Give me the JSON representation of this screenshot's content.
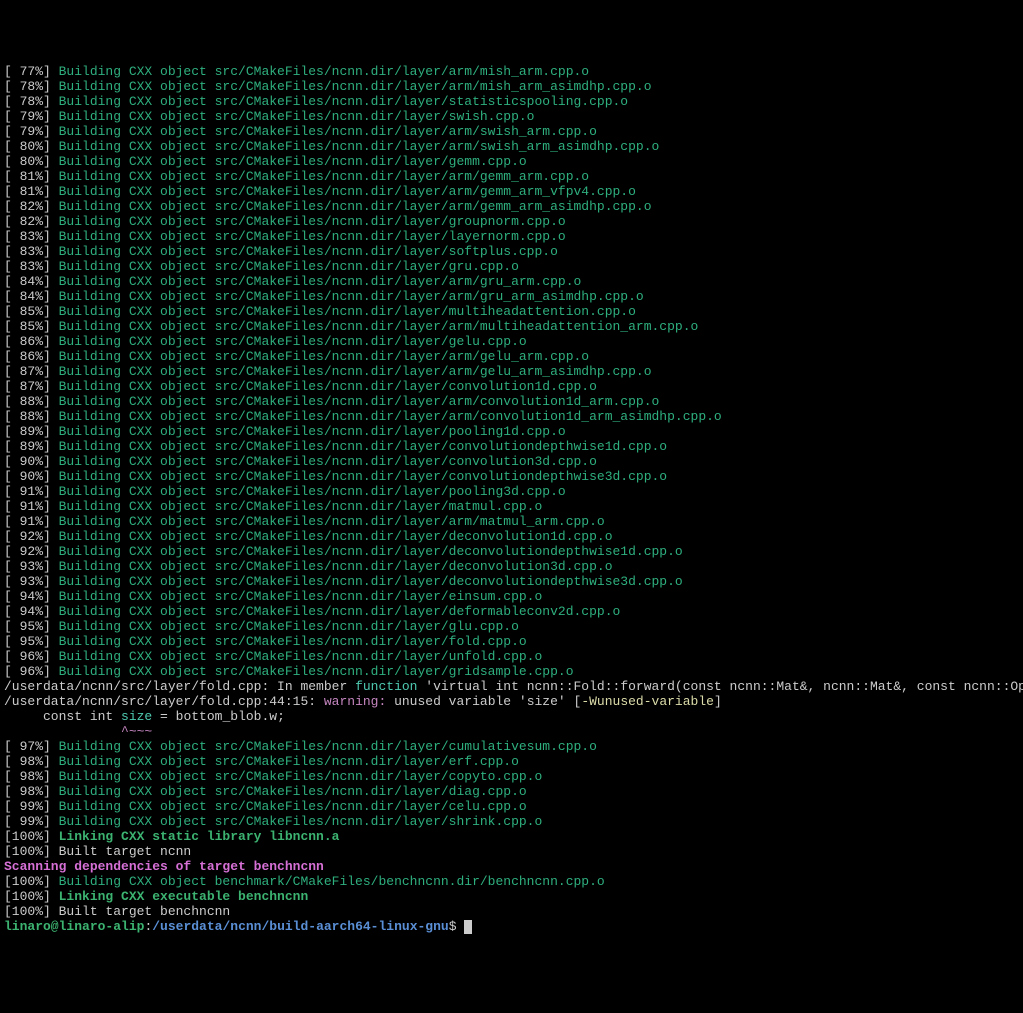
{
  "build_lines": [
    {
      "pct": " 77%",
      "text": "Building CXX object src/CMakeFiles/ncnn.dir/layer/arm/mish_arm.cpp.o"
    },
    {
      "pct": " 78%",
      "text": "Building CXX object src/CMakeFiles/ncnn.dir/layer/arm/mish_arm_asimdhp.cpp.o"
    },
    {
      "pct": " 78%",
      "text": "Building CXX object src/CMakeFiles/ncnn.dir/layer/statisticspooling.cpp.o"
    },
    {
      "pct": " 79%",
      "text": "Building CXX object src/CMakeFiles/ncnn.dir/layer/swish.cpp.o"
    },
    {
      "pct": " 79%",
      "text": "Building CXX object src/CMakeFiles/ncnn.dir/layer/arm/swish_arm.cpp.o"
    },
    {
      "pct": " 80%",
      "text": "Building CXX object src/CMakeFiles/ncnn.dir/layer/arm/swish_arm_asimdhp.cpp.o"
    },
    {
      "pct": " 80%",
      "text": "Building CXX object src/CMakeFiles/ncnn.dir/layer/gemm.cpp.o"
    },
    {
      "pct": " 81%",
      "text": "Building CXX object src/CMakeFiles/ncnn.dir/layer/arm/gemm_arm.cpp.o"
    },
    {
      "pct": " 81%",
      "text": "Building CXX object src/CMakeFiles/ncnn.dir/layer/arm/gemm_arm_vfpv4.cpp.o"
    },
    {
      "pct": " 82%",
      "text": "Building CXX object src/CMakeFiles/ncnn.dir/layer/arm/gemm_arm_asimdhp.cpp.o"
    },
    {
      "pct": " 82%",
      "text": "Building CXX object src/CMakeFiles/ncnn.dir/layer/groupnorm.cpp.o"
    },
    {
      "pct": " 83%",
      "text": "Building CXX object src/CMakeFiles/ncnn.dir/layer/layernorm.cpp.o"
    },
    {
      "pct": " 83%",
      "text": "Building CXX object src/CMakeFiles/ncnn.dir/layer/softplus.cpp.o"
    },
    {
      "pct": " 83%",
      "text": "Building CXX object src/CMakeFiles/ncnn.dir/layer/gru.cpp.o"
    },
    {
      "pct": " 84%",
      "text": "Building CXX object src/CMakeFiles/ncnn.dir/layer/arm/gru_arm.cpp.o"
    },
    {
      "pct": " 84%",
      "text": "Building CXX object src/CMakeFiles/ncnn.dir/layer/arm/gru_arm_asimdhp.cpp.o"
    },
    {
      "pct": " 85%",
      "text": "Building CXX object src/CMakeFiles/ncnn.dir/layer/multiheadattention.cpp.o"
    },
    {
      "pct": " 85%",
      "text": "Building CXX object src/CMakeFiles/ncnn.dir/layer/arm/multiheadattention_arm.cpp.o"
    },
    {
      "pct": " 86%",
      "text": "Building CXX object src/CMakeFiles/ncnn.dir/layer/gelu.cpp.o"
    },
    {
      "pct": " 86%",
      "text": "Building CXX object src/CMakeFiles/ncnn.dir/layer/arm/gelu_arm.cpp.o"
    },
    {
      "pct": " 87%",
      "text": "Building CXX object src/CMakeFiles/ncnn.dir/layer/arm/gelu_arm_asimdhp.cpp.o"
    },
    {
      "pct": " 87%",
      "text": "Building CXX object src/CMakeFiles/ncnn.dir/layer/convolution1d.cpp.o"
    },
    {
      "pct": " 88%",
      "text": "Building CXX object src/CMakeFiles/ncnn.dir/layer/arm/convolution1d_arm.cpp.o"
    },
    {
      "pct": " 88%",
      "text": "Building CXX object src/CMakeFiles/ncnn.dir/layer/arm/convolution1d_arm_asimdhp.cpp.o"
    },
    {
      "pct": " 89%",
      "text": "Building CXX object src/CMakeFiles/ncnn.dir/layer/pooling1d.cpp.o"
    },
    {
      "pct": " 89%",
      "text": "Building CXX object src/CMakeFiles/ncnn.dir/layer/convolutiondepthwise1d.cpp.o"
    },
    {
      "pct": " 90%",
      "text": "Building CXX object src/CMakeFiles/ncnn.dir/layer/convolution3d.cpp.o"
    },
    {
      "pct": " 90%",
      "text": "Building CXX object src/CMakeFiles/ncnn.dir/layer/convolutiondepthwise3d.cpp.o"
    },
    {
      "pct": " 91%",
      "text": "Building CXX object src/CMakeFiles/ncnn.dir/layer/pooling3d.cpp.o"
    },
    {
      "pct": " 91%",
      "text": "Building CXX object src/CMakeFiles/ncnn.dir/layer/matmul.cpp.o"
    },
    {
      "pct": " 91%",
      "text": "Building CXX object src/CMakeFiles/ncnn.dir/layer/arm/matmul_arm.cpp.o"
    },
    {
      "pct": " 92%",
      "text": "Building CXX object src/CMakeFiles/ncnn.dir/layer/deconvolution1d.cpp.o"
    },
    {
      "pct": " 92%",
      "text": "Building CXX object src/CMakeFiles/ncnn.dir/layer/deconvolutiondepthwise1d.cpp.o"
    },
    {
      "pct": " 93%",
      "text": "Building CXX object src/CMakeFiles/ncnn.dir/layer/deconvolution3d.cpp.o"
    },
    {
      "pct": " 93%",
      "text": "Building CXX object src/CMakeFiles/ncnn.dir/layer/deconvolutiondepthwise3d.cpp.o"
    },
    {
      "pct": " 94%",
      "text": "Building CXX object src/CMakeFiles/ncnn.dir/layer/einsum.cpp.o"
    },
    {
      "pct": " 94%",
      "text": "Building CXX object src/CMakeFiles/ncnn.dir/layer/deformableconv2d.cpp.o"
    },
    {
      "pct": " 95%",
      "text": "Building CXX object src/CMakeFiles/ncnn.dir/layer/glu.cpp.o"
    },
    {
      "pct": " 95%",
      "text": "Building CXX object src/CMakeFiles/ncnn.dir/layer/fold.cpp.o"
    },
    {
      "pct": " 96%",
      "text": "Building CXX object src/CMakeFiles/ncnn.dir/layer/unfold.cpp.o"
    },
    {
      "pct": " 96%",
      "text": "Building CXX object src/CMakeFiles/ncnn.dir/layer/gridsample.cpp.o"
    }
  ],
  "warn": {
    "file1_prefix": "/userdata/ncnn/src/layer/fold.cpp: In member ",
    "function_kw": "function",
    "file1_suffix": " 'virtual int ncnn::Fold::forward(const ncnn::Mat&, ncnn::Mat&, const ncnn::Option&) const':",
    "file2_prefix": "/userdata/ncnn/src/layer/fold.cpp:44:15: ",
    "warning_kw": "warning: ",
    "warn_msg": "unused variable 'size' [",
    "flag": "-Wunused-variable",
    "flag_close": "]",
    "code_prefix": "     const int ",
    "size_kw": "size",
    "code_suffix": " = bottom_blob.w;",
    "caret": "               ^~~~"
  },
  "build_lines2": [
    {
      "pct": " 97%",
      "text": "Building CXX object src/CMakeFiles/ncnn.dir/layer/cumulativesum.cpp.o"
    },
    {
      "pct": " 98%",
      "text": "Building CXX object src/CMakeFiles/ncnn.dir/layer/erf.cpp.o"
    },
    {
      "pct": " 98%",
      "text": "Building CXX object src/CMakeFiles/ncnn.dir/layer/copyto.cpp.o"
    },
    {
      "pct": " 98%",
      "text": "Building CXX object src/CMakeFiles/ncnn.dir/layer/diag.cpp.o"
    },
    {
      "pct": " 99%",
      "text": "Building CXX object src/CMakeFiles/ncnn.dir/layer/celu.cpp.o"
    },
    {
      "pct": " 99%",
      "text": "Building CXX object src/CMakeFiles/ncnn.dir/layer/shrink.cpp.o"
    }
  ],
  "link1": {
    "pct": "100%",
    "text": "Linking CXX static library libncnn.a"
  },
  "built1": {
    "pct": "100%",
    "text": "Built target ncnn"
  },
  "scan": "Scanning dependencies of target benchncnn",
  "build_bench": {
    "pct": "100%",
    "text": "Building CXX object benchmark/CMakeFiles/benchncnn.dir/benchncnn.cpp.o"
  },
  "link2": {
    "pct": "100%",
    "text": "Linking CXX executable benchncnn"
  },
  "built2": {
    "pct": "100%",
    "text": "Built target benchncnn"
  },
  "prompt": {
    "userhost": "linaro@linaro-alip",
    "colon": ":",
    "path": "/userdata/ncnn/build-aarch64-linux-gnu",
    "dollar": "$ "
  }
}
